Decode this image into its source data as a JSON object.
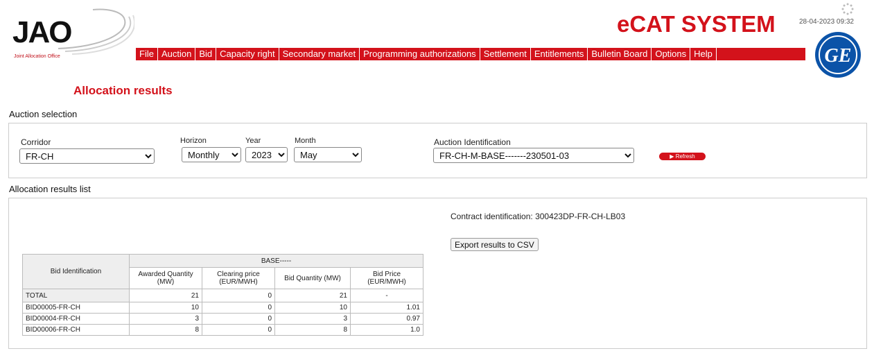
{
  "header": {
    "logo_text": "JAO",
    "logo_sub": "Joint Allocation Office",
    "brand": "eCAT SYSTEM",
    "datetime": "28-04-2023 09:32",
    "menu": [
      "File",
      "Auction",
      "Bid",
      "Capacity right",
      "Secondary market",
      "Programming authorizations",
      "Settlement",
      "Entitlements",
      "Bulletin Board",
      "Options",
      "Help"
    ]
  },
  "page_title": "Allocation results",
  "auction_selection": {
    "label": "Auction selection",
    "corridor_label": "Corridor",
    "corridor_value": "FR-CH",
    "horizon_label": "Horizon",
    "horizon_value": "Monthly",
    "year_label": "Year",
    "year_value": "2023",
    "month_label": "Month",
    "month_value": "May",
    "auction_id_label": "Auction Identification",
    "auction_id_value": "FR-CH-M-BASE-------230501-03",
    "refresh_label": "Refresh"
  },
  "results": {
    "label": "Allocation results list",
    "contract": "Contract identification: 300423DP-FR-CH-LB03",
    "export_label": "Export results to CSV",
    "group_header": "BASE-----",
    "columns": {
      "bid_id": "Bid Identification",
      "awarded": "Awarded Quantity (MW)",
      "clearing": "Clearing price (EUR/MWH)",
      "bid_qty": "Bid Quantity (MW)",
      "bid_price": "Bid Price (EUR/MWH)"
    },
    "rows": [
      {
        "id": "TOTAL",
        "awarded": "21",
        "clearing": "0",
        "bid_qty": "21",
        "bid_price": "-"
      },
      {
        "id": "BID00005-FR-CH",
        "awarded": "10",
        "clearing": "0",
        "bid_qty": "10",
        "bid_price": "1.01"
      },
      {
        "id": "BID00004-FR-CH",
        "awarded": "3",
        "clearing": "0",
        "bid_qty": "3",
        "bid_price": "0.97"
      },
      {
        "id": "BID00006-FR-CH",
        "awarded": "8",
        "clearing": "0",
        "bid_qty": "8",
        "bid_price": "1.0"
      }
    ]
  },
  "colors": {
    "accent": "#d3121b",
    "ge_blue": "#0b53a8"
  }
}
